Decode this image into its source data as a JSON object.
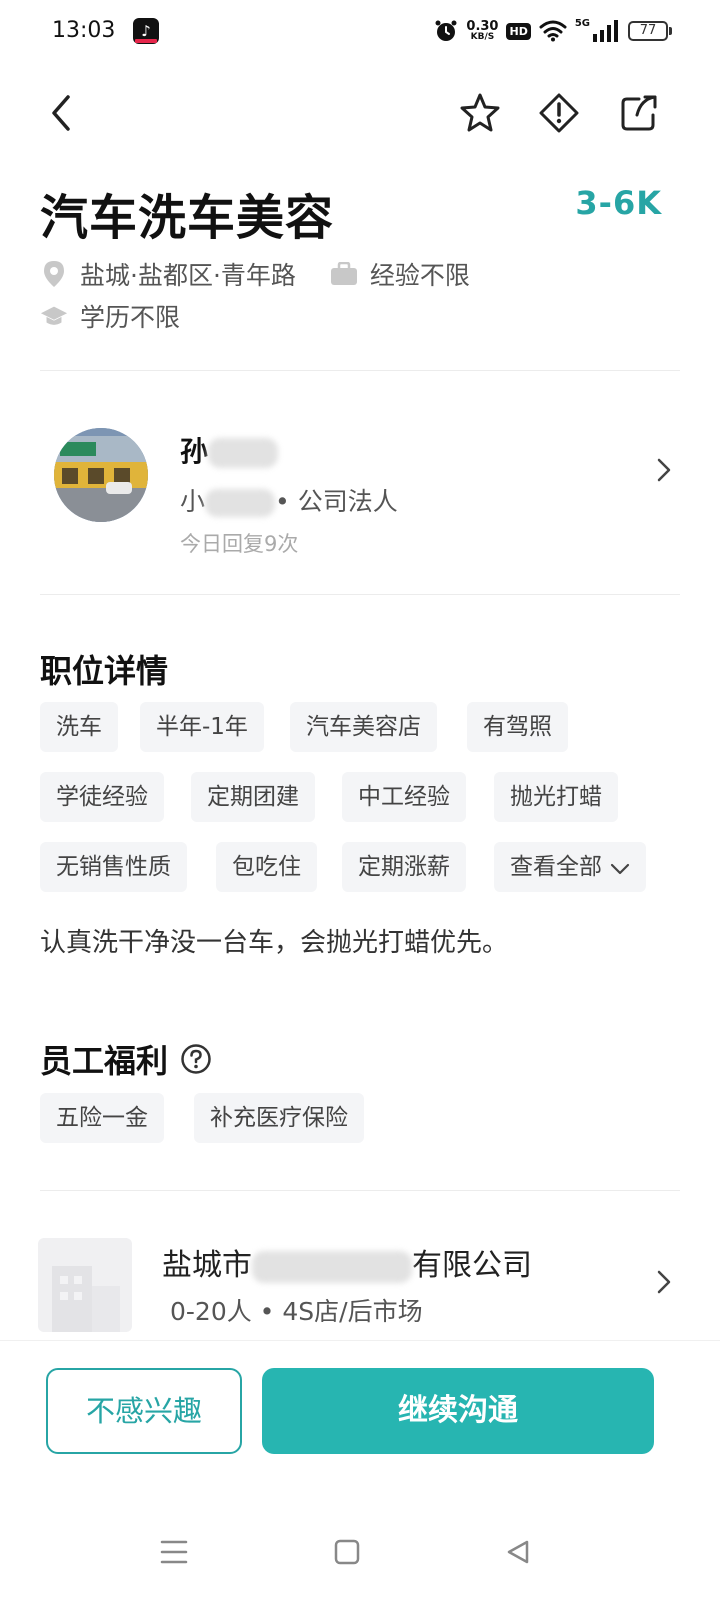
{
  "status_bar": {
    "time": "13:03",
    "net_speed": "0.30",
    "net_unit": "KB/S",
    "hd": "HD",
    "signal_label": "5G",
    "battery": "77",
    "icons": [
      "tiktok-icon",
      "alarm-icon",
      "wifi-icon",
      "signal-icon",
      "battery-icon"
    ]
  },
  "nav": {
    "icons": [
      "back-icon",
      "star-icon",
      "report-icon",
      "share-icon"
    ]
  },
  "job": {
    "title": "汽车洗车美容",
    "salary": "3-6K",
    "location": "盐城·盐都区·青年路",
    "experience": "经验不限",
    "education": "学历不限"
  },
  "recruiter": {
    "name_prefix": "孙",
    "role_prefix": "小",
    "role_suffix": "• 公司法人",
    "reply": "今日回复9次"
  },
  "details": {
    "title": "职位详情",
    "tags": [
      "洗车",
      "半年-1年",
      "汽车美容店",
      "有驾照",
      "学徒经验",
      "定期团建",
      "中工经验",
      "抛光打蜡",
      "无销售性质",
      "包吃住",
      "定期涨薪"
    ],
    "view_all": "查看全部",
    "description": "认真洗干净没一台车，会抛光打蜡优先。"
  },
  "benefits": {
    "title": "员工福利",
    "tags": [
      "五险一金",
      "补充医疗保险"
    ]
  },
  "company": {
    "name_prefix": "盐城市",
    "name_suffix": "有限公司",
    "info": "0-20人 • 4S店/后市场"
  },
  "actions": {
    "ignore_label": "不感兴趣",
    "continue_label": "继续沟通"
  },
  "colors": {
    "accent": "#27a5a5",
    "primary_button": "#27b5b1",
    "tag_bg": "#f4f5f7"
  }
}
